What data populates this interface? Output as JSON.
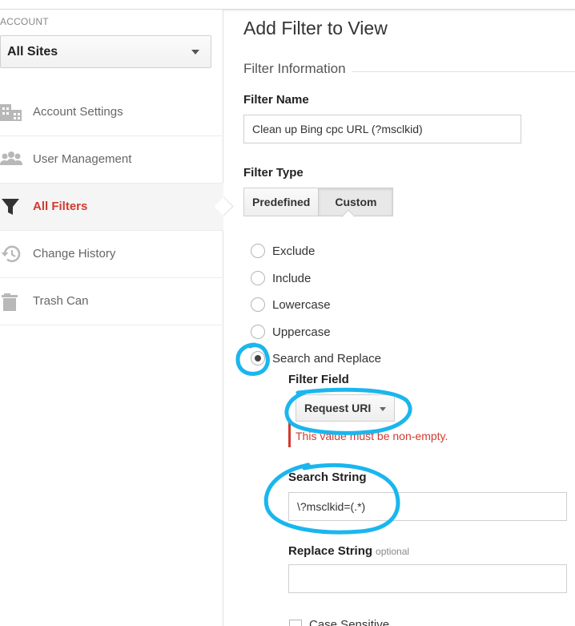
{
  "sidebar": {
    "account_label": "ACCOUNT",
    "account_value": "All Sites",
    "items": [
      {
        "label": "Account Settings",
        "icon": "building-icon"
      },
      {
        "label": "User Management",
        "icon": "users-icon"
      },
      {
        "label": "All Filters",
        "icon": "filter-icon",
        "active": true
      },
      {
        "label": "Change History",
        "icon": "history-icon"
      },
      {
        "label": "Trash Can",
        "icon": "trash-icon"
      }
    ]
  },
  "main": {
    "title": "Add Filter to View",
    "section": "Filter Information",
    "filter_name_label": "Filter Name",
    "filter_name_value": "Clean up Bing cpc URL (?msclkid)",
    "filter_type_label": "Filter Type",
    "type_buttons": [
      "Predefined",
      "Custom"
    ],
    "selected_type": "Custom",
    "options": [
      "Exclude",
      "Include",
      "Lowercase",
      "Uppercase",
      "Search and Replace"
    ],
    "selected_option": "Search and Replace",
    "filter_field_label": "Filter Field",
    "filter_field_value": "Request URI",
    "error_message": "This value must be non-empty.",
    "search_string_label": "Search String",
    "search_string_value": "\\?msclkid=(.*)",
    "replace_string_label": "Replace String",
    "replace_optional": "optional",
    "replace_string_value": "",
    "case_sensitive_label": "Case Sensitive"
  },
  "colors": {
    "active": "#d13b2f",
    "annotation": "#1ab6ee"
  }
}
